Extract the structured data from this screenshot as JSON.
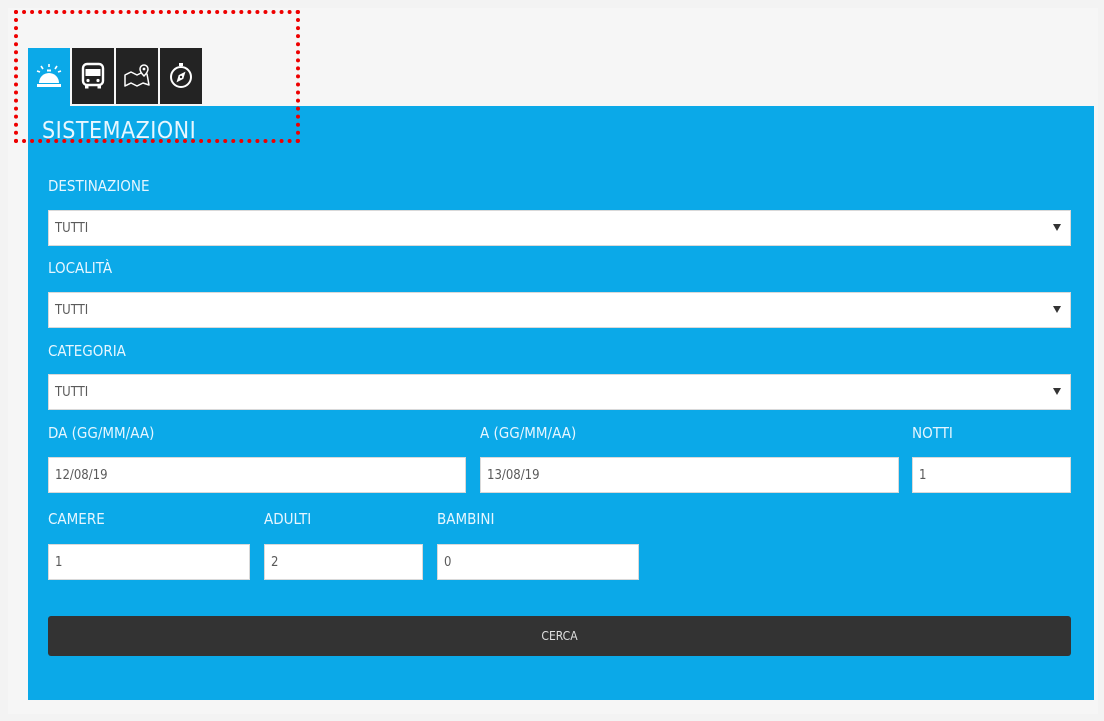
{
  "tabs": [
    {
      "name": "accommodation",
      "icon": "service-bell-icon",
      "active": true
    },
    {
      "name": "transport",
      "icon": "bus-icon",
      "active": false
    },
    {
      "name": "tours",
      "icon": "map-pin-icon",
      "active": false
    },
    {
      "name": "excursions",
      "icon": "compass-icon",
      "active": false
    }
  ],
  "panel": {
    "title": "SISTEMAZIONI"
  },
  "form": {
    "destinazione": {
      "label": "DESTINAZIONE",
      "value": "TUTTI"
    },
    "localita": {
      "label": "LOCALITÀ",
      "value": "TUTTI"
    },
    "categoria": {
      "label": "CATEGORIA",
      "value": "TUTTI"
    },
    "da": {
      "label": "DA (GG/MM/AA)",
      "value": "12/08/19"
    },
    "a": {
      "label": "A (GG/MM/AA)",
      "value": "13/08/19"
    },
    "notti": {
      "label": "NOTTI",
      "value": "1"
    },
    "camere": {
      "label": "CAMERE",
      "value": "1"
    },
    "adulti": {
      "label": "ADULTI",
      "value": "2"
    },
    "bambini": {
      "label": "BAMBINI",
      "value": "0"
    },
    "submit_label": "CERCA"
  },
  "colors": {
    "panel": "#0ba9e8",
    "tab": "#232323",
    "button": "#333333",
    "highlight": "#ee0000"
  }
}
